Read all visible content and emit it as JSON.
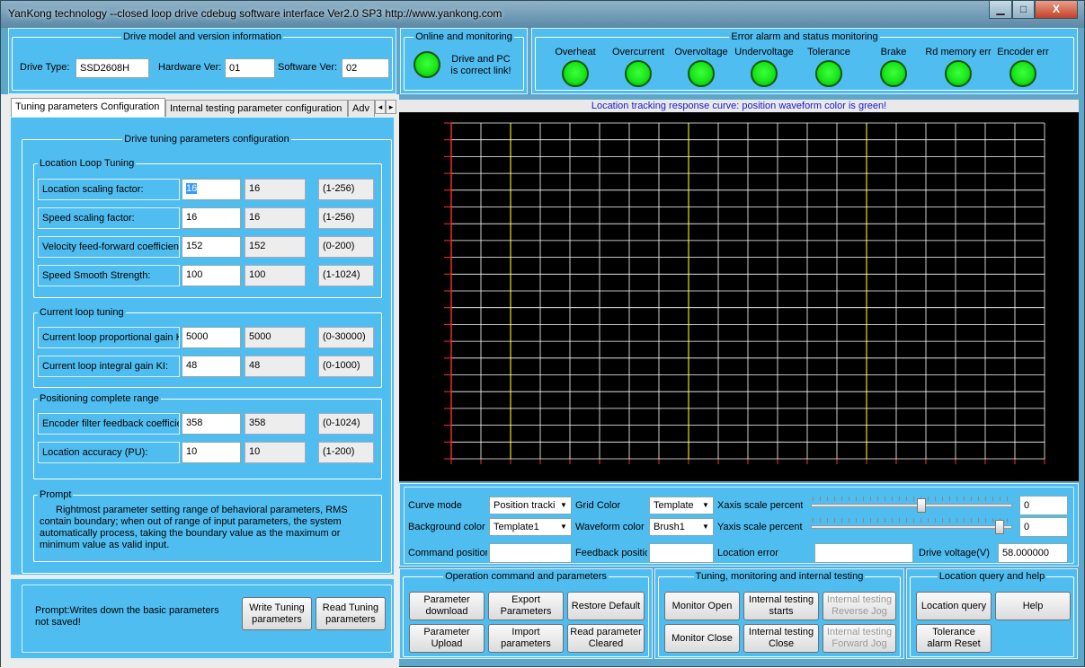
{
  "window": {
    "title": "YanKong technology --closed loop drive cdebug software interface Ver2.0 SP3   http://www.yankong.com",
    "min_glyph": "▁",
    "max_glyph": "□",
    "close_glyph": "X"
  },
  "drive_info": {
    "title": "Drive model and version information",
    "drive_type_label": "Drive Type:",
    "drive_type": "SSD2608H",
    "hardware_label": "Hardware Ver:",
    "hardware": "01",
    "software_label": "Software Ver:",
    "software": "02"
  },
  "online": {
    "title": "Online and monitoring",
    "status": "Drive and PC is correct link!",
    "led_color": "#19e619"
  },
  "alarms": {
    "title": "Error alarm and status monitoring",
    "items": [
      "Overheat",
      "Overcurrent",
      "Overvoltage",
      "Undervoltage",
      "Tolerance",
      "Brake",
      "Rd memory err",
      "Encoder err"
    ],
    "led_color": "#19e619"
  },
  "tabs": {
    "items": [
      "Tuning parameters Configuration",
      "Internal testing parameter configuration",
      "Adv"
    ],
    "active": 0,
    "prev_glyph": "◂",
    "next_glyph": "▸"
  },
  "tuning": {
    "title": "Drive tuning parameters configuration",
    "location_loop": {
      "title": "Location Loop Tuning",
      "rows": [
        {
          "label": "Location scaling factor:",
          "value": "16",
          "current": "16",
          "range": "(1-256)"
        },
        {
          "label": "Speed scaling factor:",
          "value": "16",
          "current": "16",
          "range": "(1-256)"
        },
        {
          "label": "Velocity feed-forward coefficien",
          "value": "152",
          "current": "152",
          "range": "(0-200)"
        },
        {
          "label": "Speed Smooth Strength:",
          "value": "100",
          "current": "100",
          "range": "(1-1024)"
        }
      ]
    },
    "current_loop": {
      "title": "Current loop tuning",
      "rows": [
        {
          "label": "Current loop proportional gain K",
          "value": "5000",
          "current": "5000",
          "range": "(0-30000)"
        },
        {
          "label": "Current loop integral gain KI:",
          "value": "48",
          "current": "48",
          "range": "(0-1000)"
        }
      ]
    },
    "positioning": {
      "title": "Positioning complete range",
      "rows": [
        {
          "label": "Encoder filter feedback coefficie",
          "value": "358",
          "current": "358",
          "range": "(0-1024)"
        },
        {
          "label": "Location accuracy (PU):",
          "value": "10",
          "current": "10",
          "range": "(1-200)"
        }
      ]
    },
    "prompt": {
      "title": "Prompt",
      "text": "Rightmost parameter setting range of behavioral parameters, RMS contain boundary; when out of range of input parameters, the system automatically process, taking the boundary value as the maximum or minimum value as valid input."
    }
  },
  "bottom_left": {
    "prompt": "Prompt:Writes down the basic parameters not saved!",
    "write_button": "Write Tuning parameters",
    "read_button": "Read Tuning parameters"
  },
  "chart": {
    "caption": "Location tracking response curve: position waveform color is green!",
    "background": "#000000",
    "grid_color": "#ffffff",
    "accent_line_color": "#e0e020",
    "tick_color": "#ff3030"
  },
  "curve_settings": {
    "curve_mode_label": "Curve mode",
    "curve_mode": "Position tracki",
    "grid_color_label": "Grid Color",
    "grid_color": "Template",
    "xaxis_label": "Xaxis scale percent",
    "xaxis_value": "0",
    "background_label": "Background color",
    "background_value": "Template1",
    "waveform_label": "Waveform color",
    "waveform_value": "Brush1",
    "yaxis_label": "Yaxis scale percent",
    "yaxis_value": "0",
    "x_slider_fraction": 0.55,
    "y_slider_fraction": 0.96,
    "command_label": "Command positior",
    "command_value": "",
    "feedback_label": "Feedback positio",
    "feedback_value": "",
    "location_error_label": "Location error",
    "location_error_value": "",
    "voltage_label": "Drive voltage(V)",
    "voltage_value": "58.000000"
  },
  "operation": {
    "title": "Operation  command and parameters",
    "buttons": [
      "Parameter download",
      "Export Parameters",
      "Restore Default",
      "Parameter Upload",
      "Import parameters",
      "Read parameter Cleared"
    ]
  },
  "monitoring": {
    "title": "Tuning, monitoring and internal testing",
    "buttons": [
      "Monitor Open",
      "Internal testing starts",
      "Internal testing Reverse Jog",
      "Monitor Close",
      "Internal testing Close",
      "Internal testing Forward Jog"
    ]
  },
  "query": {
    "title": "Location query and help",
    "buttons": [
      "Location query",
      "Help",
      "Tolerance alarm Reset"
    ]
  }
}
